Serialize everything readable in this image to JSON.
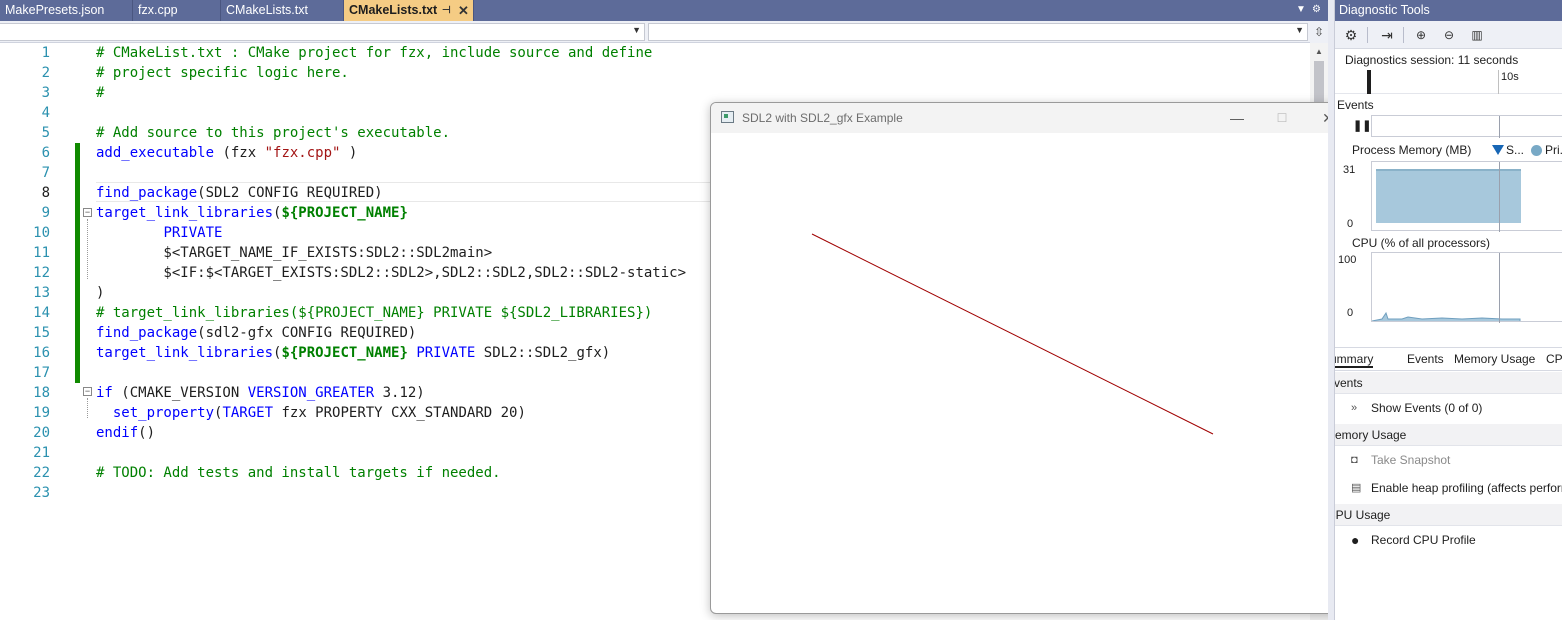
{
  "editor": {
    "tabs": [
      {
        "label": "MakePresets.json"
      },
      {
        "label": "fzx.cpp"
      },
      {
        "label": "CMakeLists.txt"
      },
      {
        "label": "CMakeLists.txt",
        "active": true
      }
    ],
    "pin_icon": "pin-icon",
    "close_icon": "close-icon",
    "lines": [
      {
        "n": "1",
        "parts": [
          [
            "com",
            "# CMakeList.txt : CMake project for fzx, include source and define"
          ]
        ]
      },
      {
        "n": "2",
        "parts": [
          [
            "com",
            "# project specific logic here."
          ]
        ]
      },
      {
        "n": "3",
        "parts": [
          [
            "com",
            "#"
          ]
        ]
      },
      {
        "n": "4",
        "parts": []
      },
      {
        "n": "5",
        "parts": [
          [
            "com",
            "# Add source to this project's executable."
          ]
        ]
      },
      {
        "n": "6",
        "parts": [
          [
            "kw",
            "add_executable"
          ],
          [
            "",
            " (fzx "
          ],
          [
            "str",
            "\"fzx.cpp\""
          ],
          [
            "",
            " )"
          ]
        ]
      },
      {
        "n": "7",
        "parts": []
      },
      {
        "n": "8",
        "parts": [
          [
            "kw",
            "find_package"
          ],
          [
            "",
            "(SDL2 CONFIG REQUIRED)"
          ]
        ]
      },
      {
        "n": "9",
        "parts": [
          [
            "kw",
            "target_link_libraries"
          ],
          [
            "",
            "("
          ],
          [
            "var",
            "${PROJECT_NAME}"
          ]
        ]
      },
      {
        "n": "10",
        "parts": [
          [
            "",
            "        "
          ],
          [
            "kw",
            "PRIVATE"
          ]
        ]
      },
      {
        "n": "11",
        "parts": [
          [
            "",
            "        $<TARGET_NAME_IF_EXISTS:SDL2::SDL2main>"
          ]
        ]
      },
      {
        "n": "12",
        "parts": [
          [
            "",
            "        $<IF:$<TARGET_EXISTS:SDL2::SDL2>,SDL2::SDL2,SDL2::SDL2-static>"
          ]
        ]
      },
      {
        "n": "13",
        "parts": [
          [
            "",
            ")"
          ]
        ]
      },
      {
        "n": "14",
        "parts": [
          [
            "com",
            "# target_link_libraries(${PROJECT_NAME} PRIVATE ${SDL2_LIBRARIES})"
          ]
        ]
      },
      {
        "n": "15",
        "parts": [
          [
            "kw",
            "find_package"
          ],
          [
            "",
            "(sdl2-gfx CONFIG REQUIRED)"
          ]
        ]
      },
      {
        "n": "16",
        "parts": [
          [
            "kw",
            "target_link_libraries"
          ],
          [
            "",
            "("
          ],
          [
            "var",
            "${PROJECT_NAME}"
          ],
          [
            "",
            " "
          ],
          [
            "kw",
            "PRIVATE"
          ],
          [
            "",
            " SDL2::SDL2_gfx)"
          ]
        ]
      },
      {
        "n": "17",
        "parts": []
      },
      {
        "n": "18",
        "parts": [
          [
            "kw",
            "if"
          ],
          [
            "",
            " (CMAKE_VERSION "
          ],
          [
            "kw",
            "VERSION_GREATER"
          ],
          [
            "",
            " 3.12)"
          ]
        ]
      },
      {
        "n": "19",
        "parts": [
          [
            "",
            "  "
          ],
          [
            "kw",
            "set_property"
          ],
          [
            "",
            "("
          ],
          [
            "kw",
            "TARGET"
          ],
          [
            "",
            " fzx PROPERTY CXX_STANDARD 20)"
          ]
        ]
      },
      {
        "n": "20",
        "parts": [
          [
            "kw",
            "endif"
          ],
          [
            "",
            "()"
          ]
        ]
      },
      {
        "n": "21",
        "parts": []
      },
      {
        "n": "22",
        "parts": [
          [
            "com",
            "# TODO: Add tests and install targets if needed."
          ]
        ]
      },
      {
        "n": "23",
        "parts": []
      }
    ],
    "current_line": "8"
  },
  "sdl_window": {
    "title": "SDL2 with SDL2_gfx Example",
    "minimize_glyph": "—",
    "maximize_glyph": "☐",
    "close_glyph": "✕",
    "line_color": "#a00000"
  },
  "diagnostics": {
    "title": "Diagnostic Tools",
    "session": "Diagnostics session: 11 seconds",
    "timeline_tick": "10s",
    "events_label": "Events",
    "memory_label": "Process Memory (MB)",
    "memory_legend_snapshot": "S...",
    "memory_legend_private": "Pri...",
    "memory_max": "31",
    "memory_min": "0",
    "cpu_label": "CPU (% of all processors)",
    "cpu_max": "100",
    "cpu_min": "0",
    "tabs": [
      "Summary",
      "Events",
      "Memory Usage",
      "CPU"
    ],
    "sections": {
      "events": {
        "title": "Events",
        "action": "Show Events (0 of 0)"
      },
      "memory": {
        "title": "Memory Usage",
        "action1": "Take Snapshot",
        "action2": "Enable heap profiling (affects performance)"
      },
      "cpu": {
        "title": "CPU Usage",
        "action": "Record CPU Profile"
      }
    },
    "accent": "#5d6b99"
  }
}
